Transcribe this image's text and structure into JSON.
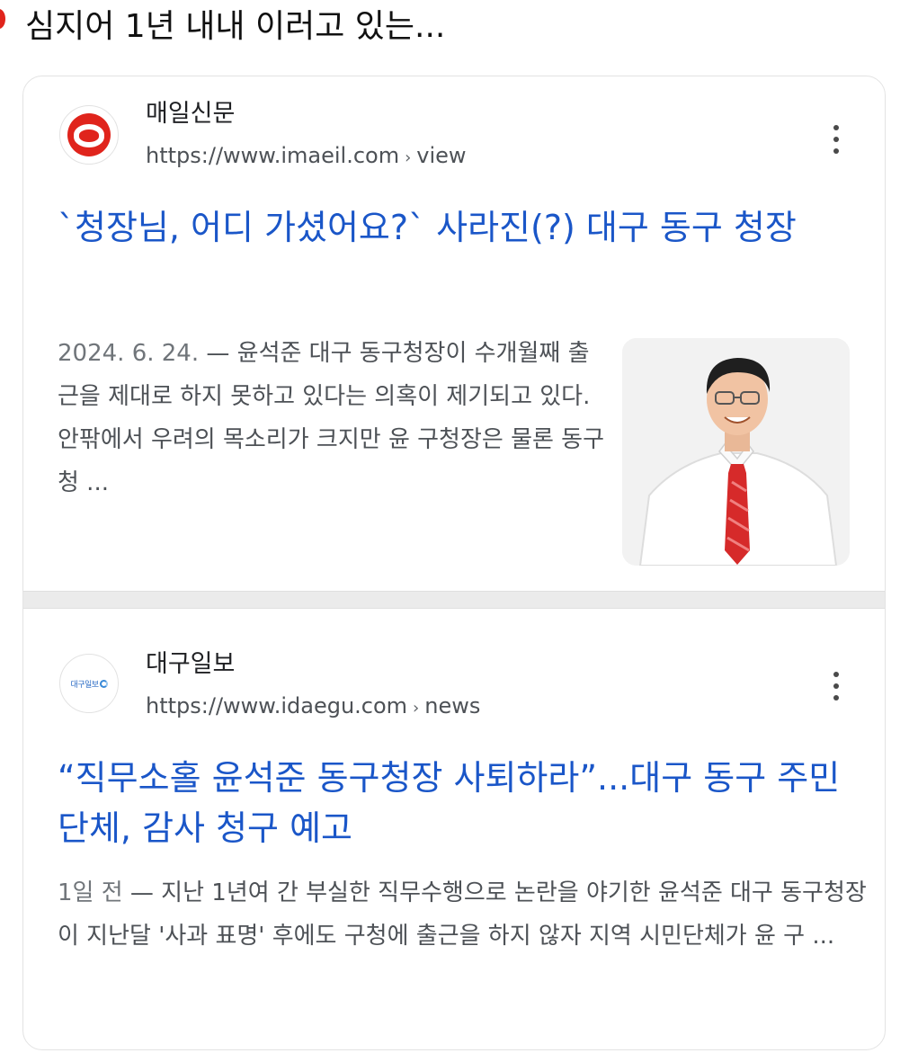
{
  "caption": "심지어 1년 내내 이러고 있는...",
  "results": [
    {
      "site_name": "매일신문",
      "url": "https://www.imaeil.com",
      "url_path": "view",
      "headline": "`청장님, 어디 가셨어요?` 사라진(?) 대구 동구 청장",
      "date": "2024. 6. 24.",
      "snippet": "— 윤석준 대구 동구청장이 수개월째 출근을 제대로 하지 못하고 있다는 의혹이 제기되고 있다. 안팎에서 우려의 목소리가 크지만 윤 구청장은 물론 동구청 ...",
      "favicon_icon": "imaeil-logo-icon",
      "has_thumbnail": true
    },
    {
      "site_name": "대구일보",
      "url": "https://www.idaegu.com",
      "url_path": "news",
      "headline": "“직무소홀 윤석준 동구청장 사퇴하라”...대구 동구 주민단체, 감사 청구 예고",
      "date": "1일 전",
      "snippet": "— 지난 1년여 간 부실한 직무수행으로 논란을 야기한 윤석준 대구 동구청장이 지난달 '사과 표명' 후에도 구청에 출근을 하지 않자 지역 시민단체가 윤 구 ...",
      "favicon_icon": "idaegu-logo-icon",
      "favicon_text": "대구일보",
      "has_thumbnail": false
    }
  ],
  "colors": {
    "headline_link": "#1a56c8",
    "snippet_text": "#4d5156",
    "brand_red": "#e0241c"
  }
}
